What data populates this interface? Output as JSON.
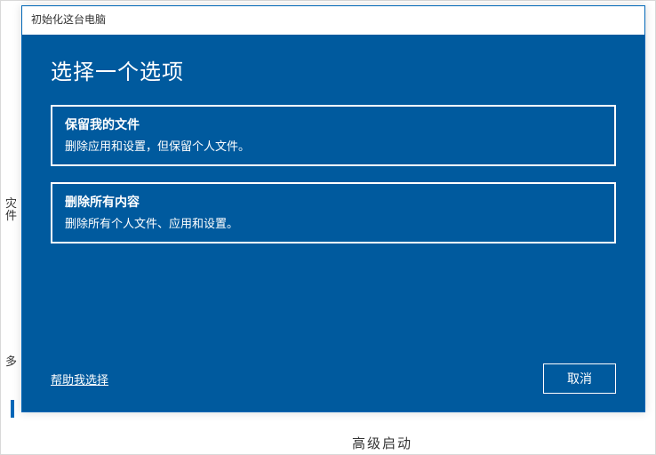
{
  "background": {
    "left1": "灾",
    "left2": "件",
    "left3": "多",
    "bottom": "高级启动"
  },
  "dialog": {
    "window_title": "初始化这台电脑",
    "heading": "选择一个选项",
    "options": [
      {
        "title": "保留我的文件",
        "desc": "删除应用和设置，但保留个人文件。"
      },
      {
        "title": "删除所有内容",
        "desc": "删除所有个人文件、应用和设置。"
      }
    ],
    "help_link": "帮助我选择",
    "cancel": "取消"
  }
}
